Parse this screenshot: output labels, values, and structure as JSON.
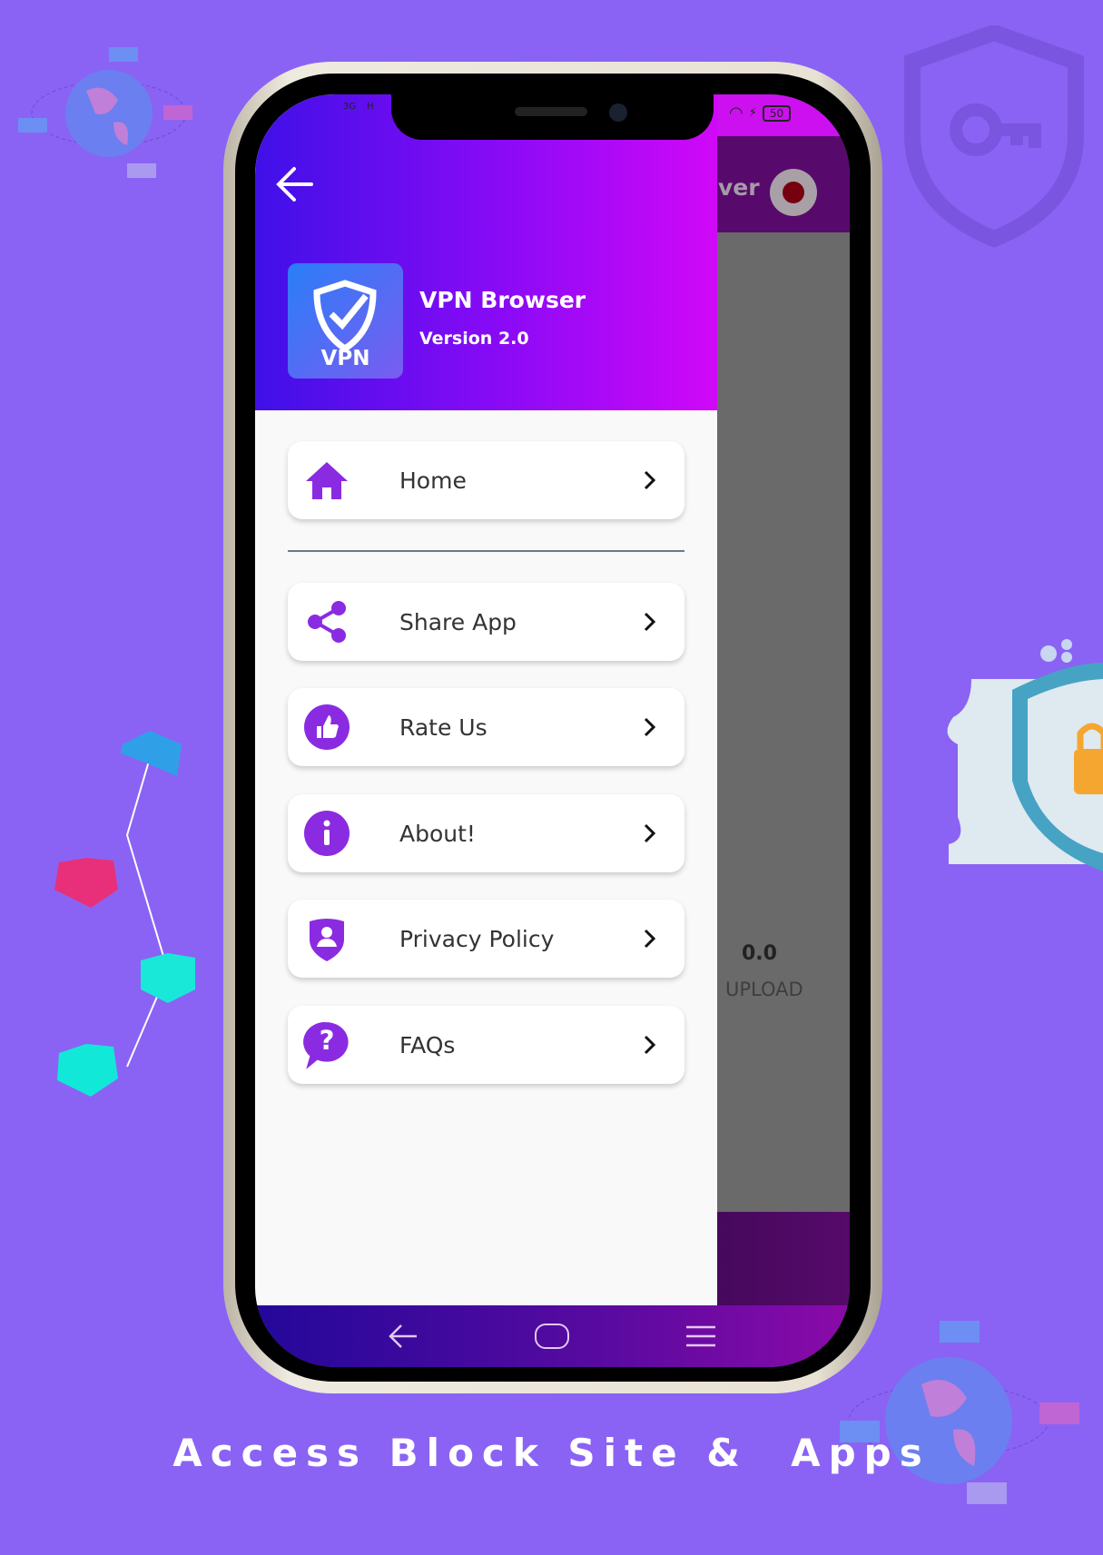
{
  "drawer": {
    "app_name": "VPN Browser",
    "version": "Version 2.0",
    "logo_text": "VPN",
    "items": [
      {
        "label": "Home",
        "icon": "home-icon"
      },
      {
        "label": "Share App",
        "icon": "share-icon"
      },
      {
        "label": "Rate Us",
        "icon": "thumbs-up-icon"
      },
      {
        "label": "About!",
        "icon": "info-icon"
      },
      {
        "label": "Privacy Policy",
        "icon": "privacy-shield-icon"
      },
      {
        "label": "FAQs",
        "icon": "question-bubble-icon"
      }
    ]
  },
  "status": {
    "network": "3G",
    "network2": "H",
    "battery": "50"
  },
  "background_app": {
    "title_fragment": "ver",
    "upload_value": "0.0",
    "upload_label": "UPLOAD"
  },
  "tagline": "Access Block Site &  Apps",
  "colors": {
    "background": "#8a63f4",
    "accent": "#8a2be2",
    "header_start": "#3f10e8",
    "header_end": "#d108f8"
  }
}
